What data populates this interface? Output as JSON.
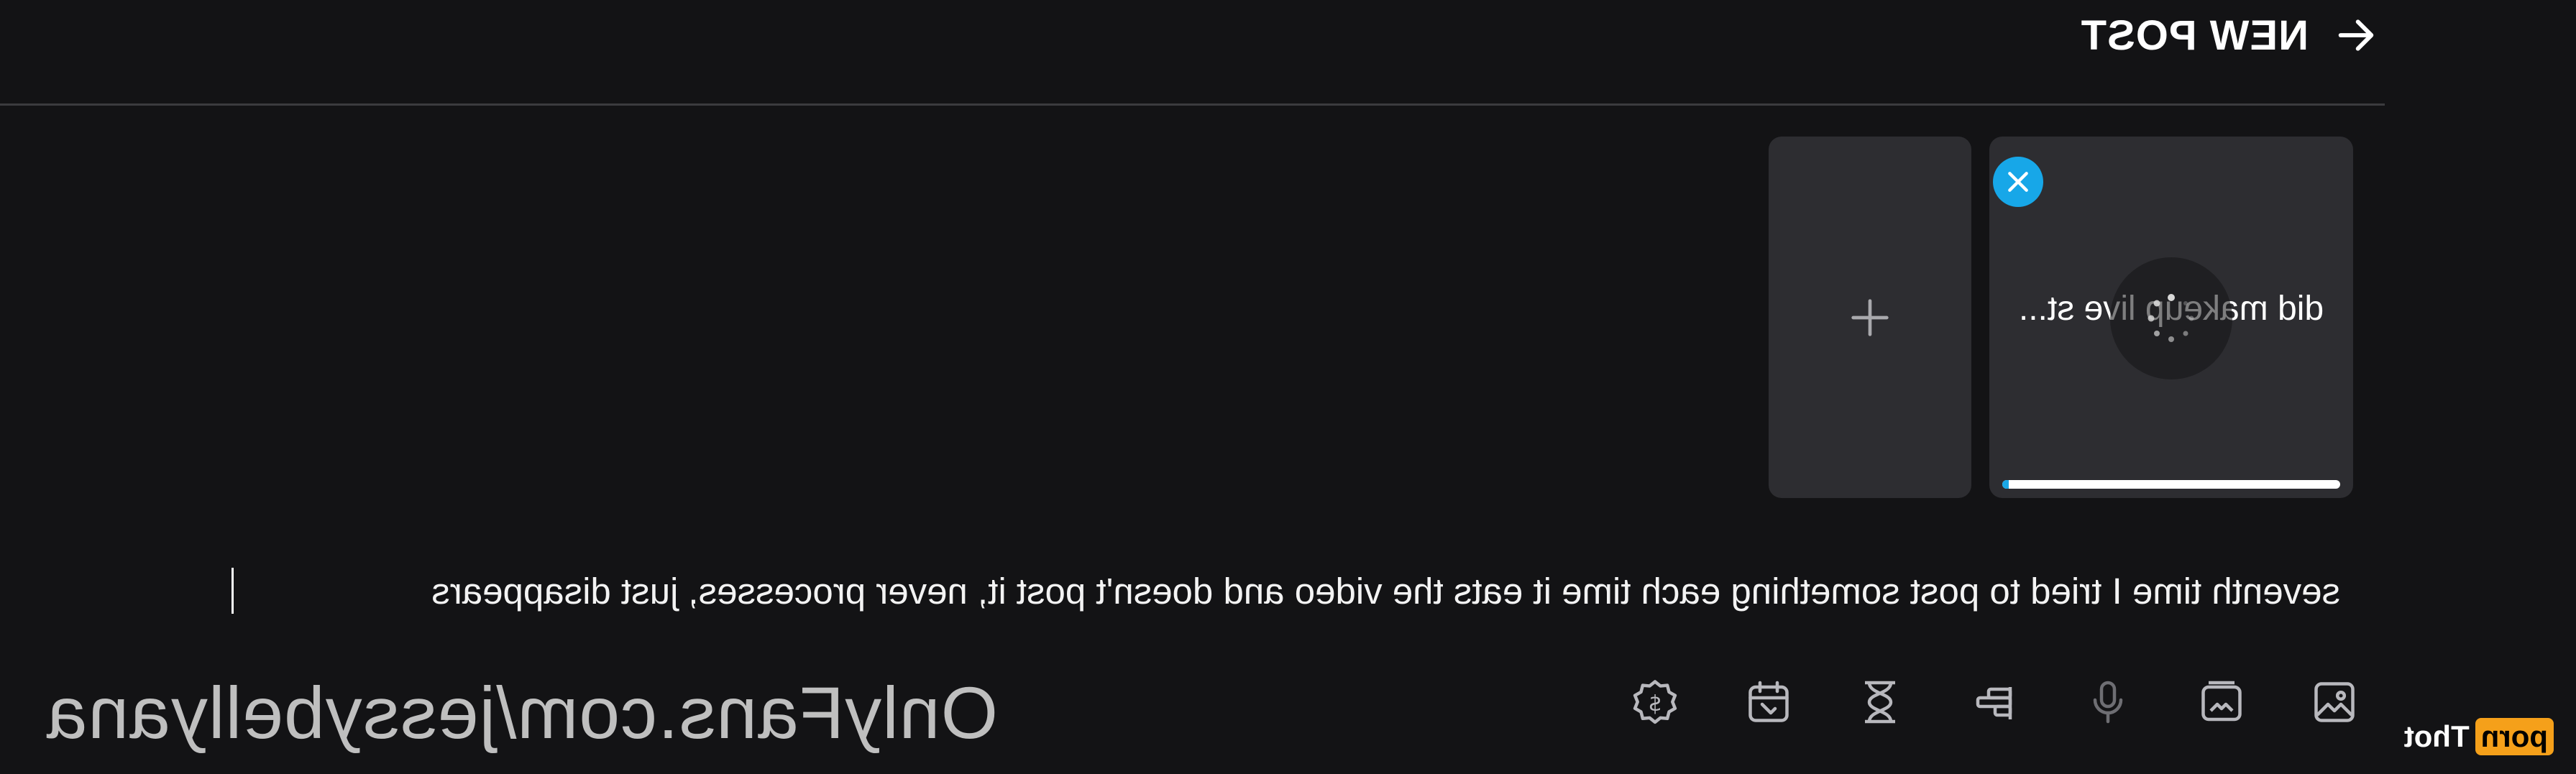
{
  "header": {
    "title": "NEW POST",
    "back_icon": "arrow-left-icon"
  },
  "media": {
    "title": "did makeup live st...",
    "upload_progress_percent": 98,
    "remove_icon": "close-icon",
    "status_icon": "spinner-icon"
  },
  "add_media": {
    "icon": "plus-icon"
  },
  "composer": {
    "text": "seventh time I tried to post something each time it eats the video and doesn't post it, never processes, just disappears"
  },
  "toolbar": {
    "icons": [
      "image-icon",
      "vault-icon",
      "microphone-icon",
      "poll-icon",
      "hourglass-icon",
      "calendar-icon",
      "price-tag-icon"
    ]
  },
  "watermark": {
    "url": "OnlyFans.com/jessybellyana"
  },
  "badge": {
    "part1": "Thot",
    "part2": "porn"
  },
  "colors": {
    "background": "#131315",
    "card": "#2d2d31",
    "accent": "#17a7e8",
    "badge": "#f5a01a"
  }
}
